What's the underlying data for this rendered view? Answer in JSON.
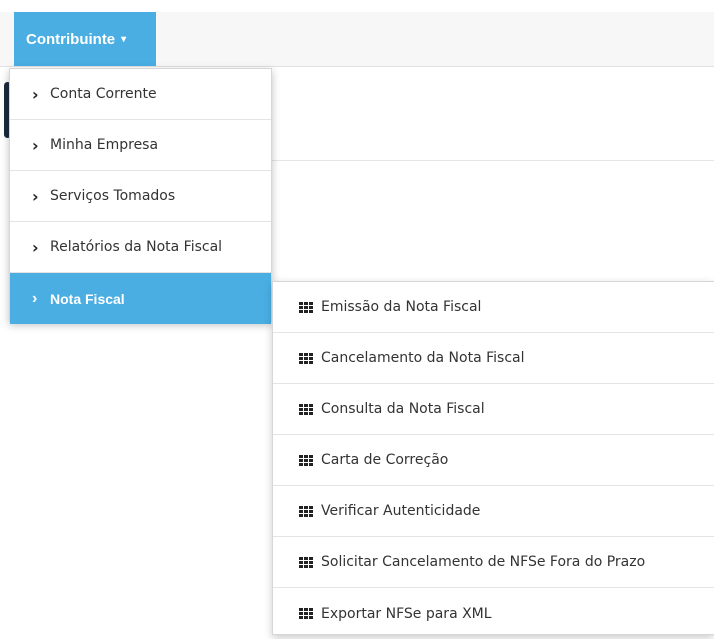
{
  "topbar": {
    "contribuinte_label": "Contribuinte",
    "caret": "▾"
  },
  "menu": {
    "items": [
      {
        "label": "Conta Corrente",
        "icon": "chevron-right-icon"
      },
      {
        "label": "Minha Empresa",
        "icon": "chevron-right-icon"
      },
      {
        "label": "Serviços Tomados",
        "icon": "chevron-right-icon"
      },
      {
        "label": "Relatórios da Nota Fiscal",
        "icon": "chevron-right-icon"
      },
      {
        "label": "Nota Fiscal",
        "icon": "chevron-right-icon",
        "active": true
      }
    ]
  },
  "submenu": {
    "items": [
      {
        "label": "Emissão da Nota Fiscal",
        "icon": "grid-icon"
      },
      {
        "label": "Cancelamento da Nota Fiscal",
        "icon": "grid-icon"
      },
      {
        "label": "Consulta da Nota Fiscal",
        "icon": "grid-icon"
      },
      {
        "label": "Carta de Correção",
        "icon": "grid-icon"
      },
      {
        "label": "Verificar Autenticidade",
        "icon": "grid-icon"
      },
      {
        "label": "Solicitar Cancelamento de NFSe Fora do Prazo",
        "icon": "grid-icon"
      },
      {
        "label": "Exportar NFSe para XML",
        "icon": "grid-icon"
      }
    ]
  },
  "colors": {
    "accent": "#4aaee3",
    "topbar_bg": "#f7f7f7"
  }
}
